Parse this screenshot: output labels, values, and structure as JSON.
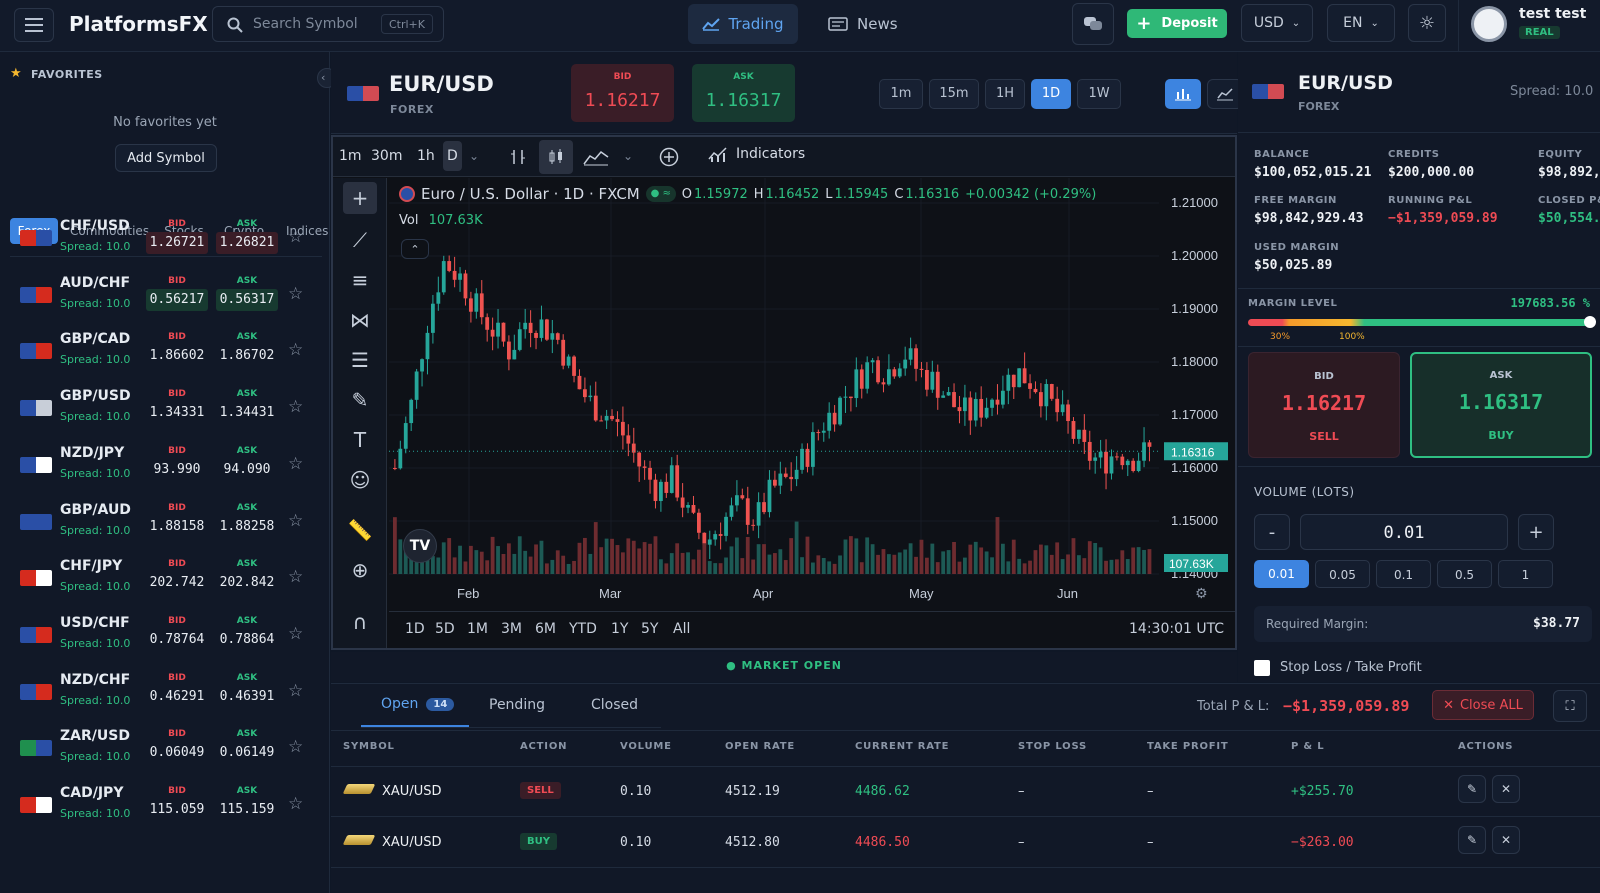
{
  "app": {
    "name": "PlatformsFX"
  },
  "search": {
    "placeholder": "Search Symbol",
    "shortcut": "Ctrl+K"
  },
  "nav": {
    "trading": "Trading",
    "news": "News"
  },
  "header": {
    "deposit": "Deposit",
    "currency": "USD",
    "lang": "EN",
    "user": "test test",
    "account_type": "REAL"
  },
  "favorites": {
    "title": "FAVORITES",
    "empty": "No favorites yet",
    "add": "Add Symbol"
  },
  "categories": [
    "Forex",
    "Commodities",
    "Stocks",
    "Crypto",
    "Indices"
  ],
  "labels": {
    "bid": "BID",
    "ask": "ASK",
    "spread": "Spread: 10.0"
  },
  "symbols": [
    {
      "name": "CHF/USD",
      "bid": "1.26721",
      "ask": "1.26821",
      "bid_bg": "#3a1d27",
      "ask_bg": "#3a1d27"
    },
    {
      "name": "AUD/CHF",
      "bid": "0.56217",
      "ask": "0.56317",
      "bid_bg": "#173a30",
      "ask_bg": "#173a30"
    },
    {
      "name": "GBP/CAD",
      "bid": "1.86602",
      "ask": "1.86702",
      "bid_bg": "",
      "ask_bg": ""
    },
    {
      "name": "GBP/USD",
      "bid": "1.34331",
      "ask": "1.34431",
      "bid_bg": "",
      "ask_bg": ""
    },
    {
      "name": "NZD/JPY",
      "bid": "93.990",
      "ask": "94.090",
      "bid_bg": "",
      "ask_bg": ""
    },
    {
      "name": "GBP/AUD",
      "bid": "1.88158",
      "ask": "1.88258",
      "bid_bg": "",
      "ask_bg": ""
    },
    {
      "name": "CHF/JPY",
      "bid": "202.742",
      "ask": "202.842",
      "bid_bg": "",
      "ask_bg": ""
    },
    {
      "name": "USD/CHF",
      "bid": "0.78764",
      "ask": "0.78864",
      "bid_bg": "",
      "ask_bg": ""
    },
    {
      "name": "NZD/CHF",
      "bid": "0.46291",
      "ask": "0.46391",
      "bid_bg": "",
      "ask_bg": ""
    },
    {
      "name": "ZAR/USD",
      "bid": "0.06049",
      "ask": "0.06149",
      "bid_bg": "",
      "ask_bg": ""
    },
    {
      "name": "CAD/JPY",
      "bid": "115.059",
      "ask": "115.159",
      "bid_bg": "",
      "ask_bg": ""
    }
  ],
  "instrument": {
    "symbol": "EUR/USD",
    "type": "FOREX",
    "bid": "1.16217",
    "ask": "1.16317",
    "spread": "Spread: 10.0"
  },
  "timeframes": [
    "1m",
    "15m",
    "1H",
    "1D",
    "1W"
  ],
  "chart_toolbar": {
    "intervals": [
      "1m",
      "30m",
      "1h",
      "D"
    ],
    "indicators": "Indicators"
  },
  "chart": {
    "title": "Euro / U.S. Dollar · 1D · FXCM",
    "o": "1.15972",
    "h": "1.16452",
    "l": "1.15945",
    "c": "1.16316",
    "chg": "+0.00342 (+0.29%)",
    "vol_label": "Vol",
    "vol": "107.63K",
    "price_tag": "1.16316",
    "vol_tag": "107.63K",
    "time": "14:30:01 UTC",
    "ranges": [
      "1D",
      "5D",
      "1M",
      "3M",
      "6M",
      "YTD",
      "1Y",
      "5Y",
      "All"
    ]
  },
  "chart_data": {
    "type": "candlestick",
    "x_ticks": [
      "Feb",
      "Mar",
      "Apr",
      "May",
      "Jun"
    ],
    "y_ticks": [
      "1.21000",
      "1.20000",
      "1.19000",
      "1.18000",
      "1.17000",
      "1.16000",
      "1.15000",
      "1.14000"
    ],
    "ylim": [
      1.14,
      1.21
    ],
    "last": 1.16316
  },
  "market_status": "MARKET OPEN",
  "account": {
    "balance_l": "BALANCE",
    "balance": "$100,052,015.21",
    "credits_l": "CREDITS",
    "credits": "$200,000.00",
    "equity_l": "EQUITY",
    "equity": "$98,892,",
    "free_l": "FREE MARGIN",
    "free": "$98,842,929.43",
    "running_l": "RUNNING P&L",
    "running": "−$1,359,059.89",
    "closed_l": "CLOSED P&",
    "closed": "$50,554.",
    "used_l": "USED MARGIN",
    "used": "$50,025.89"
  },
  "margin": {
    "label": "MARGIN LEVEL",
    "value": "197683.56 %",
    "m30": "30%",
    "m100": "100%",
    "fill": 1.0
  },
  "trade": {
    "sell": "SELL",
    "buy": "BUY",
    "volume_label": "VOLUME (LOTS)",
    "minus": "-",
    "plus": "+",
    "volume": "0.01",
    "presets": [
      "0.01",
      "0.05",
      "0.1",
      "0.5",
      "1"
    ],
    "req_label": "Required Margin:",
    "req": "$38.77",
    "sltp": "Stop Loss / Take Profit"
  },
  "positions": {
    "tabs": [
      "Open",
      "Pending",
      "Closed"
    ],
    "open_count": "14",
    "total_label": "Total P & L:",
    "total": "−$1,359,059.89",
    "close_all": "Close ALL",
    "headers": [
      "SYMBOL",
      "ACTION",
      "VOLUME",
      "OPEN RATE",
      "CURRENT RATE",
      "STOP LOSS",
      "TAKE PROFIT",
      "P & L",
      "ACTIONS"
    ],
    "rows": [
      {
        "symbol": "XAU/USD",
        "action": "SELL",
        "volume": "0.10",
        "open": "4512.19",
        "current": "4486.62",
        "sl": "–",
        "tp": "–",
        "pl": "+$255.70"
      },
      {
        "symbol": "XAU/USD",
        "action": "BUY",
        "volume": "0.10",
        "open": "4512.80",
        "current": "4486.50",
        "sl": "–",
        "tp": "–",
        "pl": "−$263.00"
      }
    ]
  }
}
